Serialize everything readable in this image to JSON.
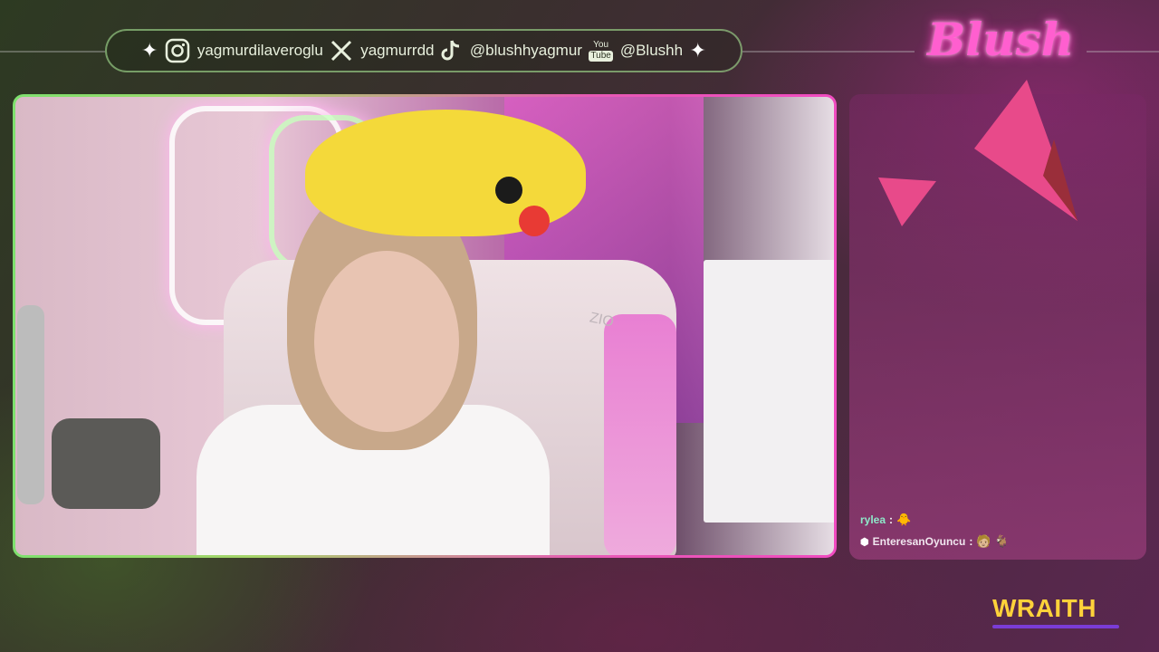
{
  "socials": {
    "instagram": "yagmurdilaveroglu",
    "x": "yagmurrdd",
    "tiktok": "@blushhyagmur",
    "youtube_badge_top": "You",
    "youtube_badge_bottom": "Tube",
    "youtube": "@Blushh"
  },
  "brand": {
    "logo_text": "Blush",
    "sponsor": "WRAITH",
    "accent_pink": "#ff5fcf",
    "accent_green": "#7ee06e",
    "sponsor_color": "#ffd23a"
  },
  "camera": {
    "chair_label": "ZIO"
  },
  "chat": {
    "messages": [
      {
        "user": "rylea",
        "separator": ":",
        "emote": "🐥"
      },
      {
        "user": "EnteresanOyuncu",
        "separator": ":",
        "emote": "🧑🏼 🐐"
      }
    ]
  },
  "icons": [
    "sparkle-icon",
    "instagram-icon",
    "x-icon",
    "tiktok-icon",
    "youtube-icon"
  ]
}
